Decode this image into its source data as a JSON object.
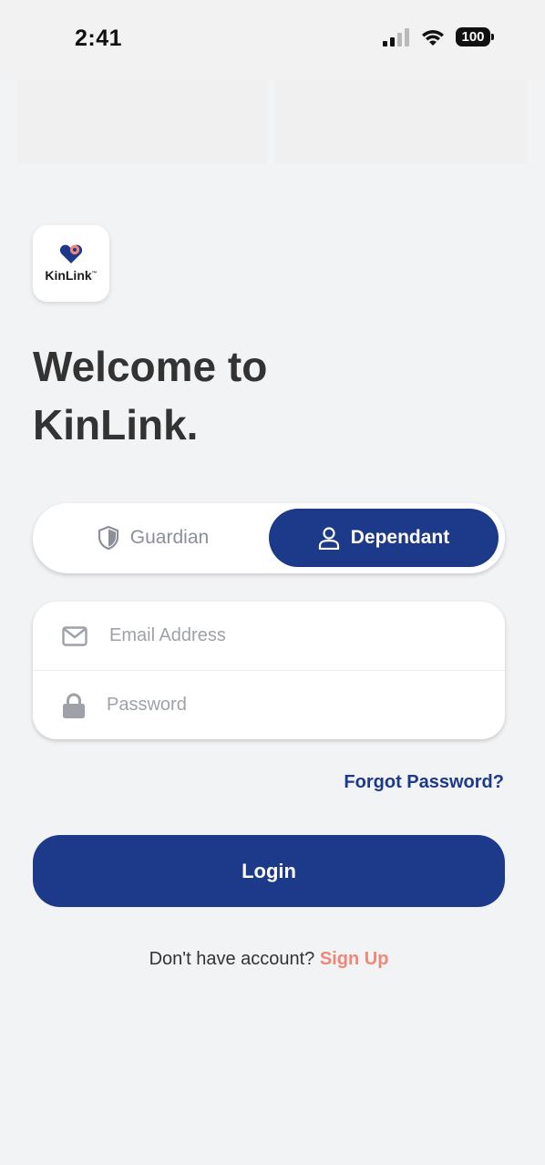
{
  "status_bar": {
    "time": "2:41",
    "battery": "100"
  },
  "logo": {
    "wordmark": "KinLink",
    "tm": "™",
    "icon": "heart-pin-icon"
  },
  "welcome": {
    "line1": "Welcome to",
    "line2": "KinLink."
  },
  "role_toggle": {
    "guardian_label": "Guardian",
    "dependant_label": "Dependant",
    "selected": "Dependant"
  },
  "form": {
    "email_placeholder": "Email Address",
    "email_value": "",
    "password_placeholder": "Password",
    "password_value": ""
  },
  "links": {
    "forgot_password": "Forgot Password?",
    "no_account": "Don't have account?",
    "sign_up": "Sign Up"
  },
  "buttons": {
    "login": "Login"
  },
  "colors": {
    "primary": "#1d3989",
    "accent": "#ef8779",
    "background": "#f2f3f5"
  }
}
